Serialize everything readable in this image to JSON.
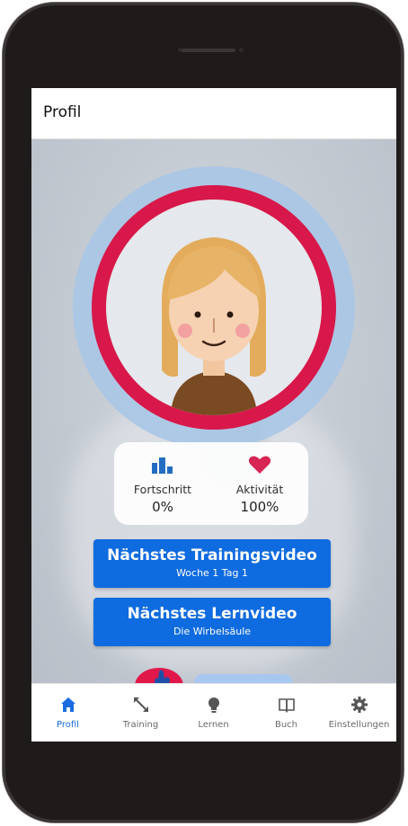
{
  "header": {
    "title": "Profil"
  },
  "stats": {
    "progress": {
      "label": "Fortschritt",
      "value": "0%",
      "icon": "bar-chart-icon",
      "color": "#1565c0"
    },
    "activity": {
      "label": "Aktivität",
      "value": "100%",
      "icon": "heart-icon",
      "color": "#d8184a"
    }
  },
  "buttons": {
    "training": {
      "title": "Nächstes Trainingsvideo",
      "subtitle": "Woche 1 Tag 1"
    },
    "learning": {
      "title": "Nächstes Lernvideo",
      "subtitle": "Die Wirbelsäule"
    }
  },
  "tabs": [
    {
      "label": "Profil",
      "icon": "home-icon",
      "active": true
    },
    {
      "label": "Training",
      "icon": "expand-arrows-icon",
      "active": false
    },
    {
      "label": "Lernen",
      "icon": "lightbulb-icon",
      "active": false
    },
    {
      "label": "Buch",
      "icon": "book-icon",
      "active": false
    },
    {
      "label": "Einstellungen",
      "icon": "gear-icon",
      "active": false
    }
  ],
  "colors": {
    "accent": "#0f6be0",
    "ring": "#d8184a",
    "ring_outer": "#a9c6e6"
  }
}
